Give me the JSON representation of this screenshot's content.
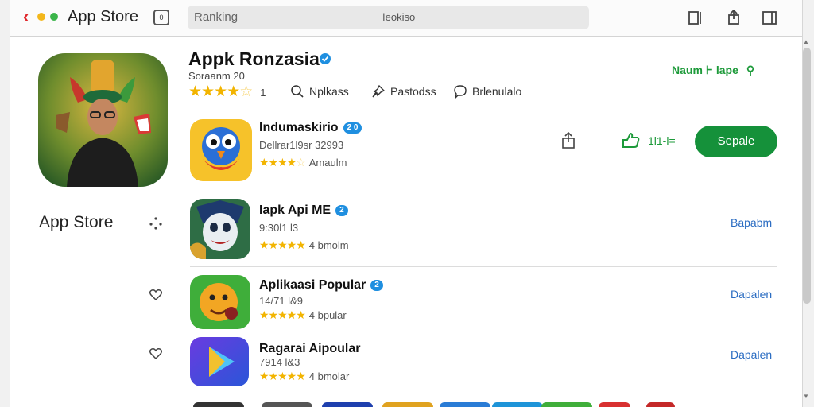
{
  "window": {
    "title": "App Store",
    "search_placeholder": "Ranking",
    "search_text": "Ɨeokiso",
    "tab_box_label": "0"
  },
  "header": {
    "app_name": "Appk Ronzasia",
    "subtitle": "Soraanm 20",
    "rating": 4.5,
    "rating_count": "1",
    "meta": [
      "Nplkass",
      "Pastodss",
      "Brlenulalo"
    ],
    "top_link": "Naum Ͱ lape"
  },
  "sidebar": {
    "label": "App Store"
  },
  "featured": {
    "title": "Indumaskirio",
    "badge": "2 0",
    "subtitle": "Dellrar1l9sr 32993",
    "rating": 4.5,
    "rating_text": "Amaulm",
    "like_count": "1l1-l=",
    "get_label": "Sepale"
  },
  "list": [
    {
      "title": "Iapk Api ME",
      "badge": "2",
      "subtitle": "9:30l1 l3",
      "rating": 5,
      "rating_text": "4 bmolm",
      "link": "Bapabm"
    },
    {
      "title": "Aplikaasi Popular",
      "badge": "2",
      "subtitle": "14/71 l&9",
      "rating": 5,
      "rating_text": "4 bpular",
      "link": "Dapalen"
    },
    {
      "title": "Ragarai Aipoular",
      "badge": "",
      "subtitle": "7914 l&3",
      "rating": 5,
      "rating_text": "4 bmolar",
      "link": "Dapalen"
    }
  ],
  "colors": {
    "accent_green": "#15913a",
    "link_blue": "#2a6cc2",
    "star": "#f2b400",
    "close_red": "#e0262b"
  },
  "icons": [
    "back-chevron-icon",
    "tab-icon",
    "split-view-icon",
    "share-icon",
    "sidebar-icon",
    "verified-icon",
    "search-icon",
    "pin-icon",
    "chat-icon",
    "like-icon",
    "heart-icon",
    "dots-icon"
  ]
}
